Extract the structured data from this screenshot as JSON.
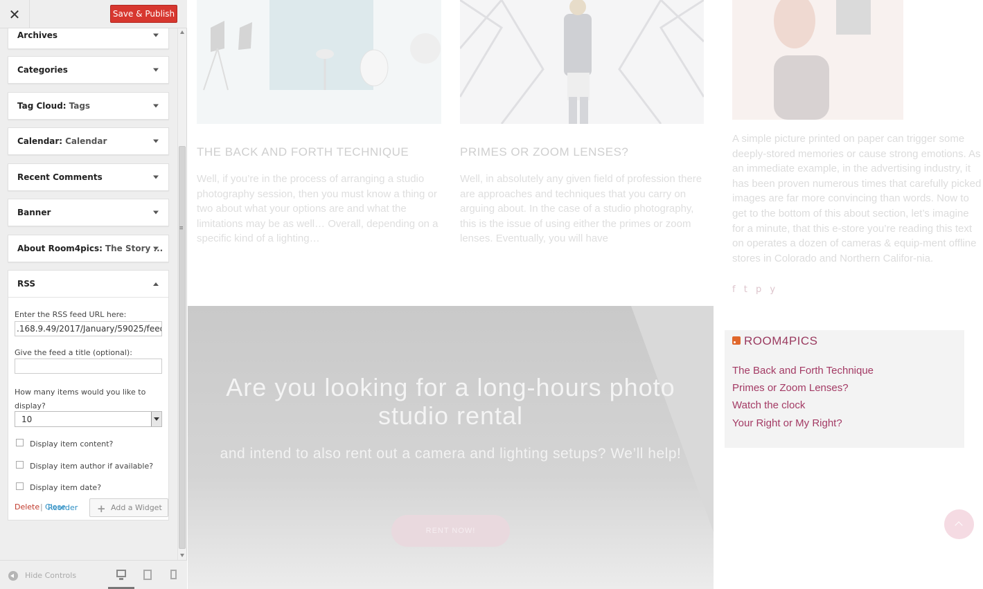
{
  "header": {
    "save_label": "Save & Publish"
  },
  "widgets": [
    {
      "title": "Archives",
      "subtitle": ""
    },
    {
      "title": "Categories",
      "subtitle": ""
    },
    {
      "title": "Tag Cloud:",
      "subtitle": "Tags"
    },
    {
      "title": "Calendar:",
      "subtitle": "Calendar"
    },
    {
      "title": "Recent Comments",
      "subtitle": ""
    },
    {
      "title": "Banner",
      "subtitle": ""
    },
    {
      "title": "About Room4pics:",
      "subtitle": "The Story ..."
    }
  ],
  "rss_form": {
    "title": "RSS",
    "url_label": "Enter the RSS feed URL here:",
    "url_value": ".168.9.49/2017/January/59025/feed",
    "title_label": "Give the feed a title (optional):",
    "title_value": "",
    "items_label": "How many items would you like to display?",
    "items_value": "10",
    "options": [
      {
        "label": "Display item content?",
        "checked": false
      },
      {
        "label": "Display item author if available?",
        "checked": false
      },
      {
        "label": "Display item date?",
        "checked": false
      }
    ],
    "delete_label": "Delete",
    "separator": "|",
    "close_label": "Close"
  },
  "footer_actions": {
    "reorder_label": "Reorder",
    "add_widget_label": "Add a Widget"
  },
  "sidebar_footer": {
    "hide_controls_label": "Hide Controls",
    "devices": [
      "desktop",
      "tablet",
      "mobile"
    ],
    "active_device": "desktop"
  },
  "preview": {
    "posts": [
      {
        "title": "THE BACK AND FORTH TECHNIQUE",
        "excerpt": "Well, if you’re in the process of arranging a studio photography session, then you must know a thing or two about what your options are and what the limitations may be as well… Overall, depending on a specific kind of a lighting…"
      },
      {
        "title": "PRIMES OR ZOOM LENSES?",
        "excerpt": "Well, in absolutely any given field of profession there are approaches and techniques that you carry on arguing about. In the case of a studio photography, this is the issue of using either the primes or zoom lenses. Eventually, you will have"
      }
    ],
    "about_text": "A simple picture printed on paper can trigger some deeply-stored memories or cause strong emotions. As an immediate example, in the advertising industry, it has been proven numerous times that carefully picked images are far more convincing than words. Now to get to the bottom of this about section, let’s imagine for a minute, that this e-store you’re reading this text on operates a dozen of cameras & equip-ment offline stores in Colorado and Northern Califor-nia.",
    "socials": "f  t  p  y",
    "banner": {
      "title": "Are you looking for a long-hours photo studio rental",
      "subtitle": "and intend to also rent out a camera and lighting setups? We’ll help!",
      "button": "RENT NOW!"
    },
    "rss_widget": {
      "title": "ROOM4PICS",
      "items": [
        "The Back and Forth Technique",
        "Primes or Zoom Lenses?",
        "Watch the clock",
        "Your Right or My Right?"
      ]
    }
  },
  "colors": {
    "accent": "#d7372f",
    "link": "#2e8fc4",
    "delete": "#c0392b",
    "rss_link": "#a33a64"
  }
}
